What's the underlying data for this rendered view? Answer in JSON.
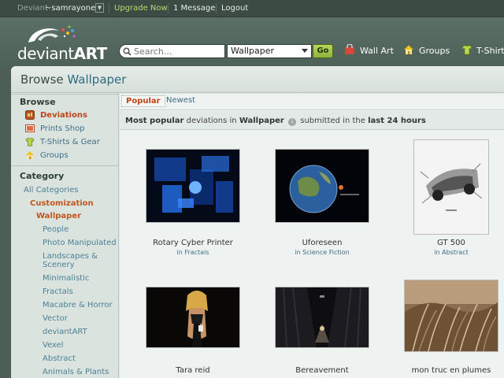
{
  "topbar": {
    "deviant_prefix": "Deviant",
    "username": "~samrayone",
    "upgrade": "Upgrade Now",
    "messages": "1 Message",
    "logout": "Logout"
  },
  "header": {
    "logo_text_a": "deviant",
    "logo_text_b": "ART",
    "search_placeholder": "Search...",
    "search_scope": "Wallpaper",
    "go_label": "Go",
    "nav": [
      {
        "label": "Wall Art",
        "icon": "shopping-bag-icon"
      },
      {
        "label": "Groups",
        "icon": "home-icon"
      },
      {
        "label": "T-Shirts",
        "icon": "tshirt-icon"
      }
    ]
  },
  "page": {
    "title_prefix": "Browse",
    "title_highlight": "Wallpaper"
  },
  "sidebar": {
    "browse_heading": "Browse",
    "browse_links": [
      {
        "label": "Deviations",
        "icon": "deviations-icon",
        "active": true
      },
      {
        "label": "Prints Shop",
        "icon": "prints-icon",
        "active": false
      },
      {
        "label": "T-Shirts & Gear",
        "icon": "tshirt-icon",
        "active": false
      },
      {
        "label": "Groups",
        "icon": "home-icon",
        "active": false
      }
    ],
    "category_heading": "Category",
    "all_categories": "All Categories",
    "customization": "Customization",
    "wallpaper": "Wallpaper",
    "subcategories": [
      "People",
      "Photo Manipulated",
      "Landscapes &",
      "Scenery",
      "Minimalistic",
      "Fractals",
      "Macabre & Horror",
      "Vector",
      "deviantART",
      "Vexel",
      "Abstract",
      "Animals & Plants"
    ]
  },
  "content": {
    "tabs": [
      "Popular",
      "Newest"
    ],
    "summary": {
      "p1": "Most popular",
      "p2": "deviations in",
      "p3": "Wallpaper",
      "p4": "submitted in the",
      "p5": "last 24 hours"
    },
    "cards": [
      {
        "title": "Rotary Cyber Printer",
        "in": "in",
        "category": "Fractals"
      },
      {
        "title": "Uforeseen",
        "in": "in",
        "category": "Science Fiction"
      },
      {
        "title": "GT 500",
        "in": "in",
        "category": "Abstract"
      },
      {
        "title": "Tara reid",
        "in": "",
        "category": ""
      },
      {
        "title": "Bereavement",
        "in": "",
        "category": ""
      },
      {
        "title": "mon truc en plumes",
        "in": "",
        "category": ""
      }
    ]
  },
  "colors": {
    "topbar": "#3d4b45",
    "header": "#566a61",
    "accent_orange": "#c0441a",
    "link_blue": "#3f6d84",
    "go_green": "#a4c84a"
  }
}
